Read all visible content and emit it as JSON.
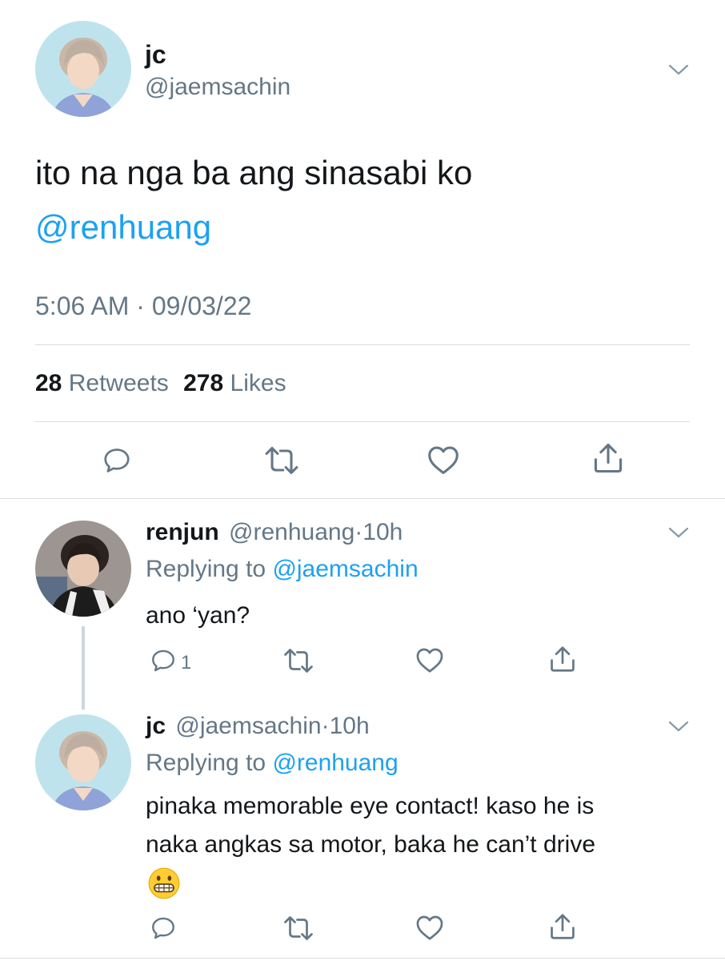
{
  "main_tweet": {
    "display_name": "jc",
    "handle": "@jaemsachin",
    "text": "ito na nga ba ang sinasabi ko",
    "mention": "@renhuang",
    "time": "5:06 AM",
    "date": "09/03/22",
    "retweet_count": "28",
    "retweet_label": "Retweets",
    "like_count": "278",
    "like_label": "Likes"
  },
  "replies": [
    {
      "display_name": "renjun",
      "handle": "@renhuang",
      "age": "10h",
      "replying_prefix": "Replying to",
      "replying_to": "@jaemsachin",
      "text": "ano ‘yan?",
      "reply_count": "1"
    },
    {
      "display_name": "jc",
      "handle": "@jaemsachin",
      "age": "10h",
      "replying_prefix": "Replying to",
      "replying_to": "@renhuang",
      "text_line1": "pinaka memorable eye contact! kaso he is",
      "text_line2": "naka angkas sa motor, baka he can’t drive",
      "emoji": "grimacing-face"
    }
  ],
  "colors": {
    "link": "#1da1f2",
    "muted": "#657786",
    "icon": "#657786",
    "divider": "#d8dde1"
  }
}
